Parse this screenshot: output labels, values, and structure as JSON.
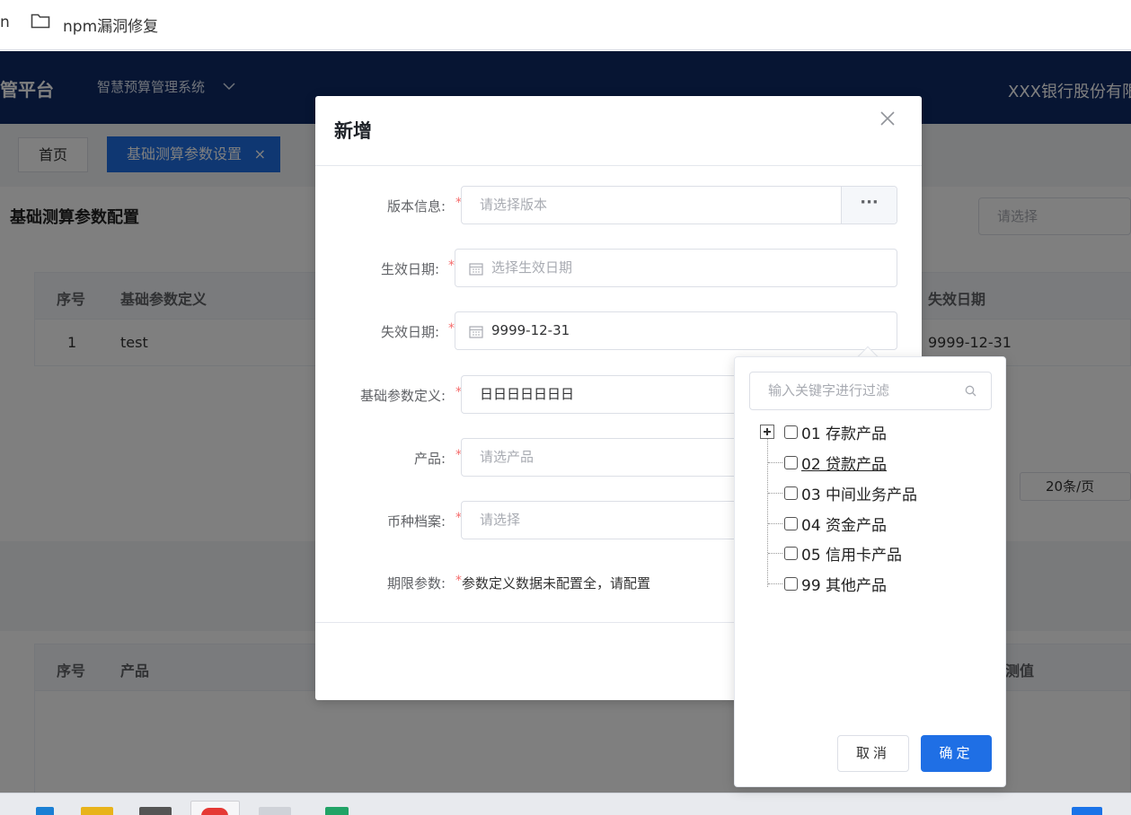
{
  "browser": {
    "bookmark_cut_text": "n",
    "bookmark_folder_label": "npm漏洞修复"
  },
  "header": {
    "brand": "财管平台",
    "system_menu": "智慧预算管理系统",
    "bank_name": "XXX银行股份有限公司"
  },
  "tabs": {
    "home": "首页",
    "active": "基础测算参数设置",
    "close_symbol": "×"
  },
  "panel": {
    "title": "基础测算参数配置",
    "select_placeholder": "请选择",
    "table_headers": [
      "序号",
      "基础参数定义",
      "失效日期"
    ],
    "rows": [
      {
        "index": "1",
        "definition": "test",
        "expire": "9999-12-31"
      }
    ],
    "page_size": "20条/页"
  },
  "panel2": {
    "table_headers": [
      "序号",
      "产品",
      "测值"
    ]
  },
  "dialog": {
    "title": "新增",
    "fields": {
      "version": {
        "label": "版本信息:",
        "placeholder": "请选择版本",
        "button": "···"
      },
      "effective_date": {
        "label": "生效日期:",
        "placeholder": "选择生效日期"
      },
      "expire_date": {
        "label": "失效日期:",
        "value": "9999-12-31"
      },
      "base_param": {
        "label": "基础参数定义:",
        "value": "日日日日日日日"
      },
      "product": {
        "label": "产品:",
        "placeholder": "请选产品"
      },
      "currency": {
        "label": "币种档案:",
        "placeholder": "请选择"
      },
      "term": {
        "label": "期限参数:",
        "message": "参数定义数据未配置全，请配置"
      }
    },
    "required_mark": "*"
  },
  "tree": {
    "filter_placeholder": "输入关键字进行过滤",
    "nodes": [
      {
        "label": "01 存款产品"
      },
      {
        "label": "02 贷款产品"
      },
      {
        "label": "03 中间业务产品"
      },
      {
        "label": "04 资金产品"
      },
      {
        "label": "05 信用卡产品"
      },
      {
        "label": "99 其他产品"
      }
    ],
    "cancel": "取消",
    "ok": "确定"
  },
  "colors": {
    "header_bg": "#0e2a66",
    "primary": "#1f6fe5",
    "required": "#f56c6c"
  }
}
